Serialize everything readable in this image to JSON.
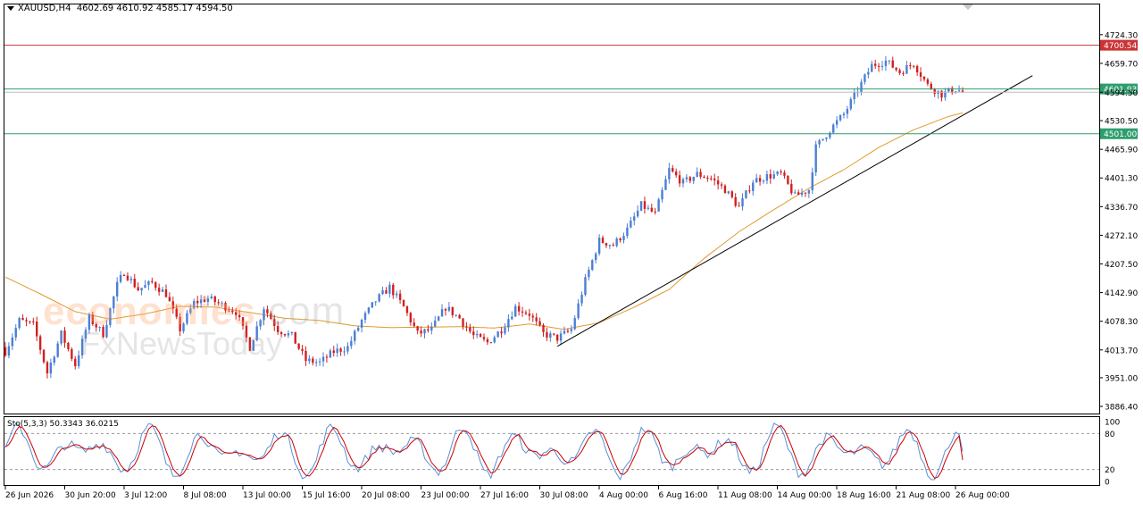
{
  "header": {
    "symbol": "XAUUSD,H4",
    "ohlc": "4602.69 4610.92 4585.17 4594.50"
  },
  "watermark": {
    "brand": "economies",
    "suffix": ".com",
    "line2": "FxNewsToday"
  },
  "levels": [
    {
      "label": "4700.54",
      "value": 4700.54,
      "color": "#cc3333"
    },
    {
      "label": "4601.93",
      "value": 4601.93,
      "color": "#2e9e6e"
    },
    {
      "label": "4501.00",
      "value": 4501.0,
      "color": "#2e9e6e"
    }
  ],
  "current_price": 4594.5,
  "stochastic": {
    "label": "Sto(5,3,3) 50.3343 36.0215",
    "main": 50.3343,
    "signal": 36.0215,
    "levels": [
      20,
      80
    ],
    "axis_labels": [
      "100",
      "80",
      "20",
      "0"
    ],
    "main_color": "#5b8fd6",
    "signal_color": "#cc0000"
  },
  "chart_data": {
    "type": "candlestick",
    "symbol": "XAUUSD",
    "timeframe": "H4",
    "ylim": [
      3886.4,
      4735
    ],
    "y_ticks": [
      "4724.30",
      "4659.70",
      "4594.50",
      "4530.50",
      "4465.90",
      "4401.30",
      "4336.70",
      "4272.10",
      "4207.50",
      "4142.90",
      "4078.30",
      "4013.70",
      "3951.00",
      "3886.40"
    ],
    "x_ticks": [
      "26 Jun 2026",
      "30 Jun 20:00",
      "3 Jul 12:00",
      "8 Jul 08:00",
      "13 Jul 00:00",
      "15 Jul 16:00",
      "20 Jul 08:00",
      "23 Jul 00:00",
      "27 Jul 16:00",
      "30 Jul 08:00",
      "4 Aug 00:00",
      "6 Aug 16:00",
      "11 Aug 08:00",
      "14 Aug 00:00",
      "18 Aug 16:00",
      "21 Aug 08:00",
      "26 Aug 00:00"
    ],
    "bull_color": "#4a7fd4",
    "bear_color": "#d22020",
    "ma_color": "#e09a30",
    "trendline": {
      "from": {
        "bar": 158,
        "price": 4022
      },
      "to": {
        "bar": 294,
        "price": 4632
      }
    },
    "close_path": [
      [
        0,
        4010
      ],
      [
        4,
        4080
      ],
      [
        8,
        4070
      ],
      [
        12,
        3962
      ],
      [
        16,
        4050
      ],
      [
        20,
        3980
      ],
      [
        24,
        4085
      ],
      [
        28,
        4050
      ],
      [
        32,
        4160
      ],
      [
        34,
        4190
      ],
      [
        38,
        4150
      ],
      [
        42,
        4165
      ],
      [
        46,
        4140
      ],
      [
        50,
        4060
      ],
      [
        54,
        4120
      ],
      [
        58,
        4130
      ],
      [
        62,
        4115
      ],
      [
        66,
        4100
      ],
      [
        70,
        4020
      ],
      [
        74,
        4110
      ],
      [
        78,
        4060
      ],
      [
        82,
        4045
      ],
      [
        86,
        3990
      ],
      [
        90,
        3985
      ],
      [
        94,
        4010
      ],
      [
        98,
        4020
      ],
      [
        102,
        4080
      ],
      [
        106,
        4125
      ],
      [
        110,
        4155
      ],
      [
        114,
        4110
      ],
      [
        118,
        4050
      ],
      [
        122,
        4060
      ],
      [
        126,
        4110
      ],
      [
        130,
        4085
      ],
      [
        134,
        4045
      ],
      [
        138,
        4030
      ],
      [
        142,
        4060
      ],
      [
        146,
        4110
      ],
      [
        150,
        4095
      ],
      [
        154,
        4050
      ],
      [
        158,
        4040
      ],
      [
        162,
        4060
      ],
      [
        166,
        4170
      ],
      [
        170,
        4260
      ],
      [
        174,
        4250
      ],
      [
        178,
        4285
      ],
      [
        182,
        4340
      ],
      [
        186,
        4320
      ],
      [
        190,
        4420
      ],
      [
        194,
        4390
      ],
      [
        198,
        4410
      ],
      [
        202,
        4400
      ],
      [
        206,
        4375
      ],
      [
        210,
        4335
      ],
      [
        214,
        4395
      ],
      [
        218,
        4405
      ],
      [
        222,
        4410
      ],
      [
        226,
        4360
      ],
      [
        230,
        4375
      ],
      [
        232,
        4470
      ],
      [
        236,
        4510
      ],
      [
        240,
        4545
      ],
      [
        244,
        4600
      ],
      [
        248,
        4655
      ],
      [
        252,
        4665
      ],
      [
        256,
        4640
      ],
      [
        260,
        4660
      ],
      [
        264,
        4610
      ],
      [
        268,
        4590
      ],
      [
        272,
        4602
      ],
      [
        274,
        4594.5
      ]
    ],
    "ma_path": [
      [
        0,
        4178
      ],
      [
        10,
        4140
      ],
      [
        20,
        4100
      ],
      [
        30,
        4083
      ],
      [
        40,
        4095
      ],
      [
        50,
        4112
      ],
      [
        60,
        4110
      ],
      [
        70,
        4098
      ],
      [
        80,
        4085
      ],
      [
        90,
        4080
      ],
      [
        100,
        4068
      ],
      [
        110,
        4064
      ],
      [
        120,
        4065
      ],
      [
        130,
        4066
      ],
      [
        140,
        4063
      ],
      [
        150,
        4072
      ],
      [
        160,
        4060
      ],
      [
        170,
        4075
      ],
      [
        180,
        4110
      ],
      [
        190,
        4150
      ],
      [
        200,
        4220
      ],
      [
        210,
        4280
      ],
      [
        220,
        4330
      ],
      [
        230,
        4378
      ],
      [
        240,
        4420
      ],
      [
        250,
        4470
      ],
      [
        260,
        4510
      ],
      [
        270,
        4540
      ],
      [
        274,
        4548
      ]
    ]
  }
}
